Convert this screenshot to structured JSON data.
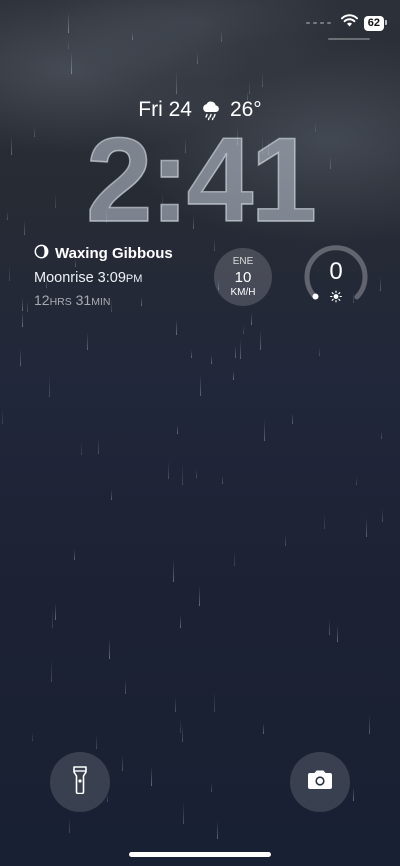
{
  "status": {
    "battery": "62",
    "wifi_icon": "wifi-icon"
  },
  "lockscreen": {
    "day": "Fri 24",
    "weather_icon": "rain-cloud-icon",
    "temperature": "26°",
    "time": "2:41"
  },
  "moon": {
    "phase": "Waxing Gibbous",
    "moonrise_label": "Moonrise 3:09",
    "moonrise_suffix": "PM",
    "duration_h": "12",
    "duration_h_unit": "HRS",
    "duration_m": "31",
    "duration_m_unit": "MIN"
  },
  "wind": {
    "direction": "ENE",
    "speed": "10",
    "unit": "KM/H"
  },
  "uv": {
    "value": "0",
    "level": 0
  },
  "quick_actions": {
    "left": "flashlight-icon",
    "right": "camera-icon"
  }
}
